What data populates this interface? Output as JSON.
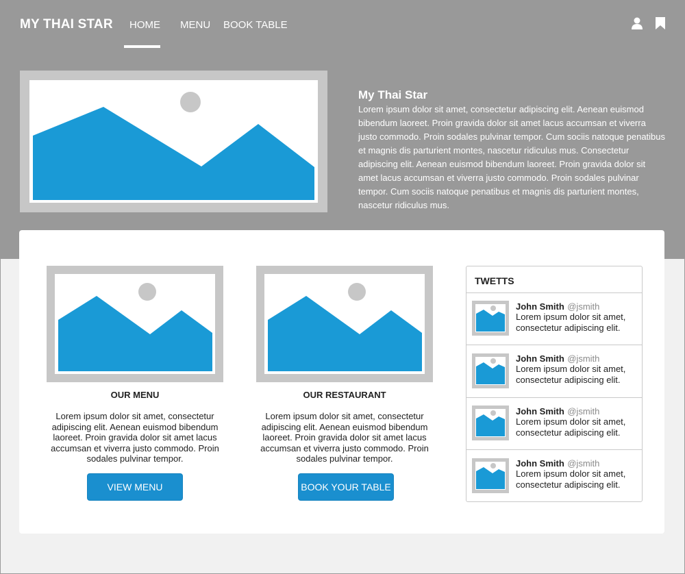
{
  "header": {
    "brand": "MY THAI STAR",
    "nav": [
      {
        "label": "HOME",
        "active": true
      },
      {
        "label": "MENU",
        "active": false
      },
      {
        "label": "BOOK TABLE",
        "active": false
      }
    ],
    "icons": [
      "user-icon",
      "bookmark-icon"
    ]
  },
  "hero": {
    "title": "My Thai Star",
    "text": "Lorem ipsum dolor sit amet, consectetur adipiscing elit. Aenean euismod bibendum laoreet. Proin gravida dolor sit amet lacus accumsan et viverra justo commodo. Proin sodales pulvinar tempor. Cum sociis natoque penatibus et magnis dis parturient montes, nascetur ridiculus mus. Consectetur adipiscing elit. Aenean euismod bibendum laoreet. Proin gravida dolor sit amet lacus accumsan et viverra justo commodo. Proin sodales pulvinar tempor. Cum sociis natoque penatibus et magnis dis parturient montes, nascetur ridiculus mus."
  },
  "features": [
    {
      "title": "OUR MENU",
      "text": "Lorem ipsum dolor sit amet, consectetur adipiscing elit. Aenean euismod bibendum laoreet. Proin gravida dolor sit amet lacus accumsan et viverra justo commodo. Proin sodales pulvinar tempor.",
      "button": "VIEW MENU"
    },
    {
      "title": "OUR RESTAURANT",
      "text": "Lorem ipsum dolor sit amet, consectetur adipiscing elit. Aenean euismod bibendum laoreet. Proin gravida dolor sit amet lacus accumsan et viverra justo commodo. Proin sodales pulvinar tempor.",
      "button": "BOOK YOUR TABLE"
    }
  ],
  "tweets": {
    "title": "TWETTS",
    "items": [
      {
        "name": "John Smith",
        "handle": "@jsmith",
        "text": "Lorem ipsum dolor sit amet, consectetur adipiscing elit."
      },
      {
        "name": "John Smith",
        "handle": "@jsmith",
        "text": "Lorem ipsum dolor sit amet, consectetur adipiscing elit."
      },
      {
        "name": "John Smith",
        "handle": "@jsmith",
        "text": "Lorem ipsum dolor sit amet, consectetur adipiscing elit."
      },
      {
        "name": "John Smith",
        "handle": "@jsmith",
        "text": "Lorem ipsum dolor sit amet, consectetur adipiscing elit."
      }
    ]
  },
  "colors": {
    "hero_bg": "#999999",
    "page_bg": "#f1f1f1",
    "accent": "#1a8fcf",
    "image_blue": "#1a9ad6",
    "image_frame": "#c7c7c7"
  }
}
